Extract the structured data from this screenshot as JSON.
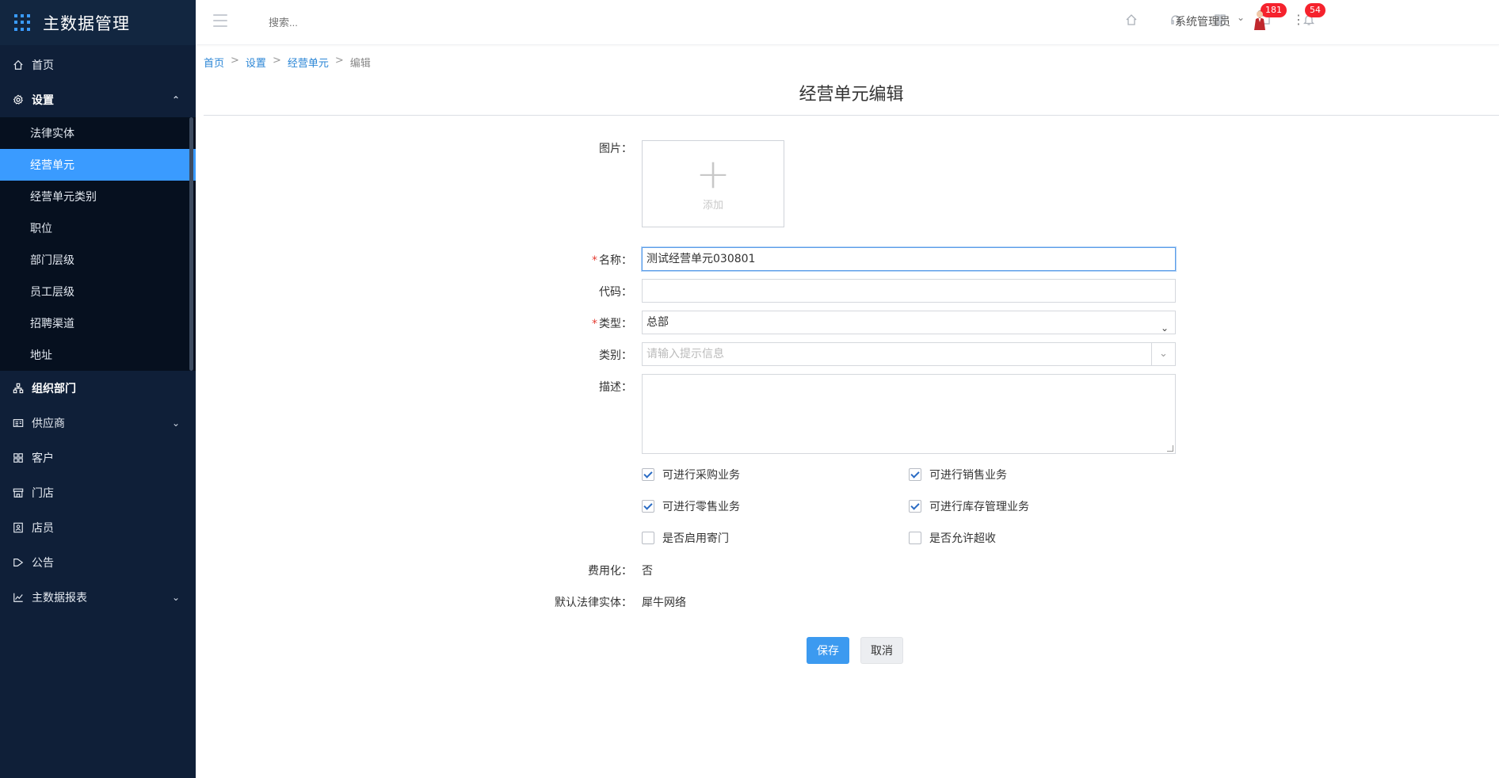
{
  "app": {
    "title": "主数据管理"
  },
  "sidebar": {
    "items": [
      {
        "label": "首页"
      },
      {
        "label": "设置",
        "expanded": true,
        "children": [
          {
            "label": "法律实体"
          },
          {
            "label": "经营单元",
            "active": true
          },
          {
            "label": "经营单元类别"
          },
          {
            "label": "职位"
          },
          {
            "label": "部门层级"
          },
          {
            "label": "员工层级"
          },
          {
            "label": "招聘渠道"
          },
          {
            "label": "地址"
          }
        ]
      },
      {
        "label": "组织部门"
      },
      {
        "label": "供应商"
      },
      {
        "label": "客户"
      },
      {
        "label": "门店"
      },
      {
        "label": "店员"
      },
      {
        "label": "公告"
      },
      {
        "label": "主数据报表"
      }
    ]
  },
  "topbar": {
    "search_placeholder": "搜索...",
    "badges": {
      "messages": "181",
      "notifications": "54"
    },
    "user_name": "系统管理员"
  },
  "breadcrumb": [
    "首页",
    "设置",
    "经营单元",
    "编辑"
  ],
  "page_title": "经营单元编辑",
  "form": {
    "image_label": "图片：",
    "upload_text": "添加",
    "name_label": "名称：",
    "name_value": "测试经营单元030801",
    "code_label": "代码：",
    "code_value": "",
    "type_label": "类型：",
    "type_value": "总部",
    "category_label": "类别：",
    "category_placeholder": "请输入提示信息",
    "desc_label": "描述：",
    "checkboxes": [
      {
        "label": "可进行采购业务",
        "checked": true
      },
      {
        "label": "可进行销售业务",
        "checked": true
      },
      {
        "label": "可进行零售业务",
        "checked": true
      },
      {
        "label": "可进行库存管理业务",
        "checked": true
      },
      {
        "label": "是否启用寄门",
        "checked": false
      },
      {
        "label": "是否允许超收",
        "checked": false
      }
    ],
    "expense_label": "费用化：",
    "expense_value": "否",
    "default_entity_label": "默认法律实体：",
    "default_entity_value": "犀牛网络",
    "save_label": "保存",
    "cancel_label": "取消"
  },
  "colors": {
    "sidebar_bg": "#0f1f38",
    "accent": "#3a9bff",
    "badge": "#f5222d"
  }
}
